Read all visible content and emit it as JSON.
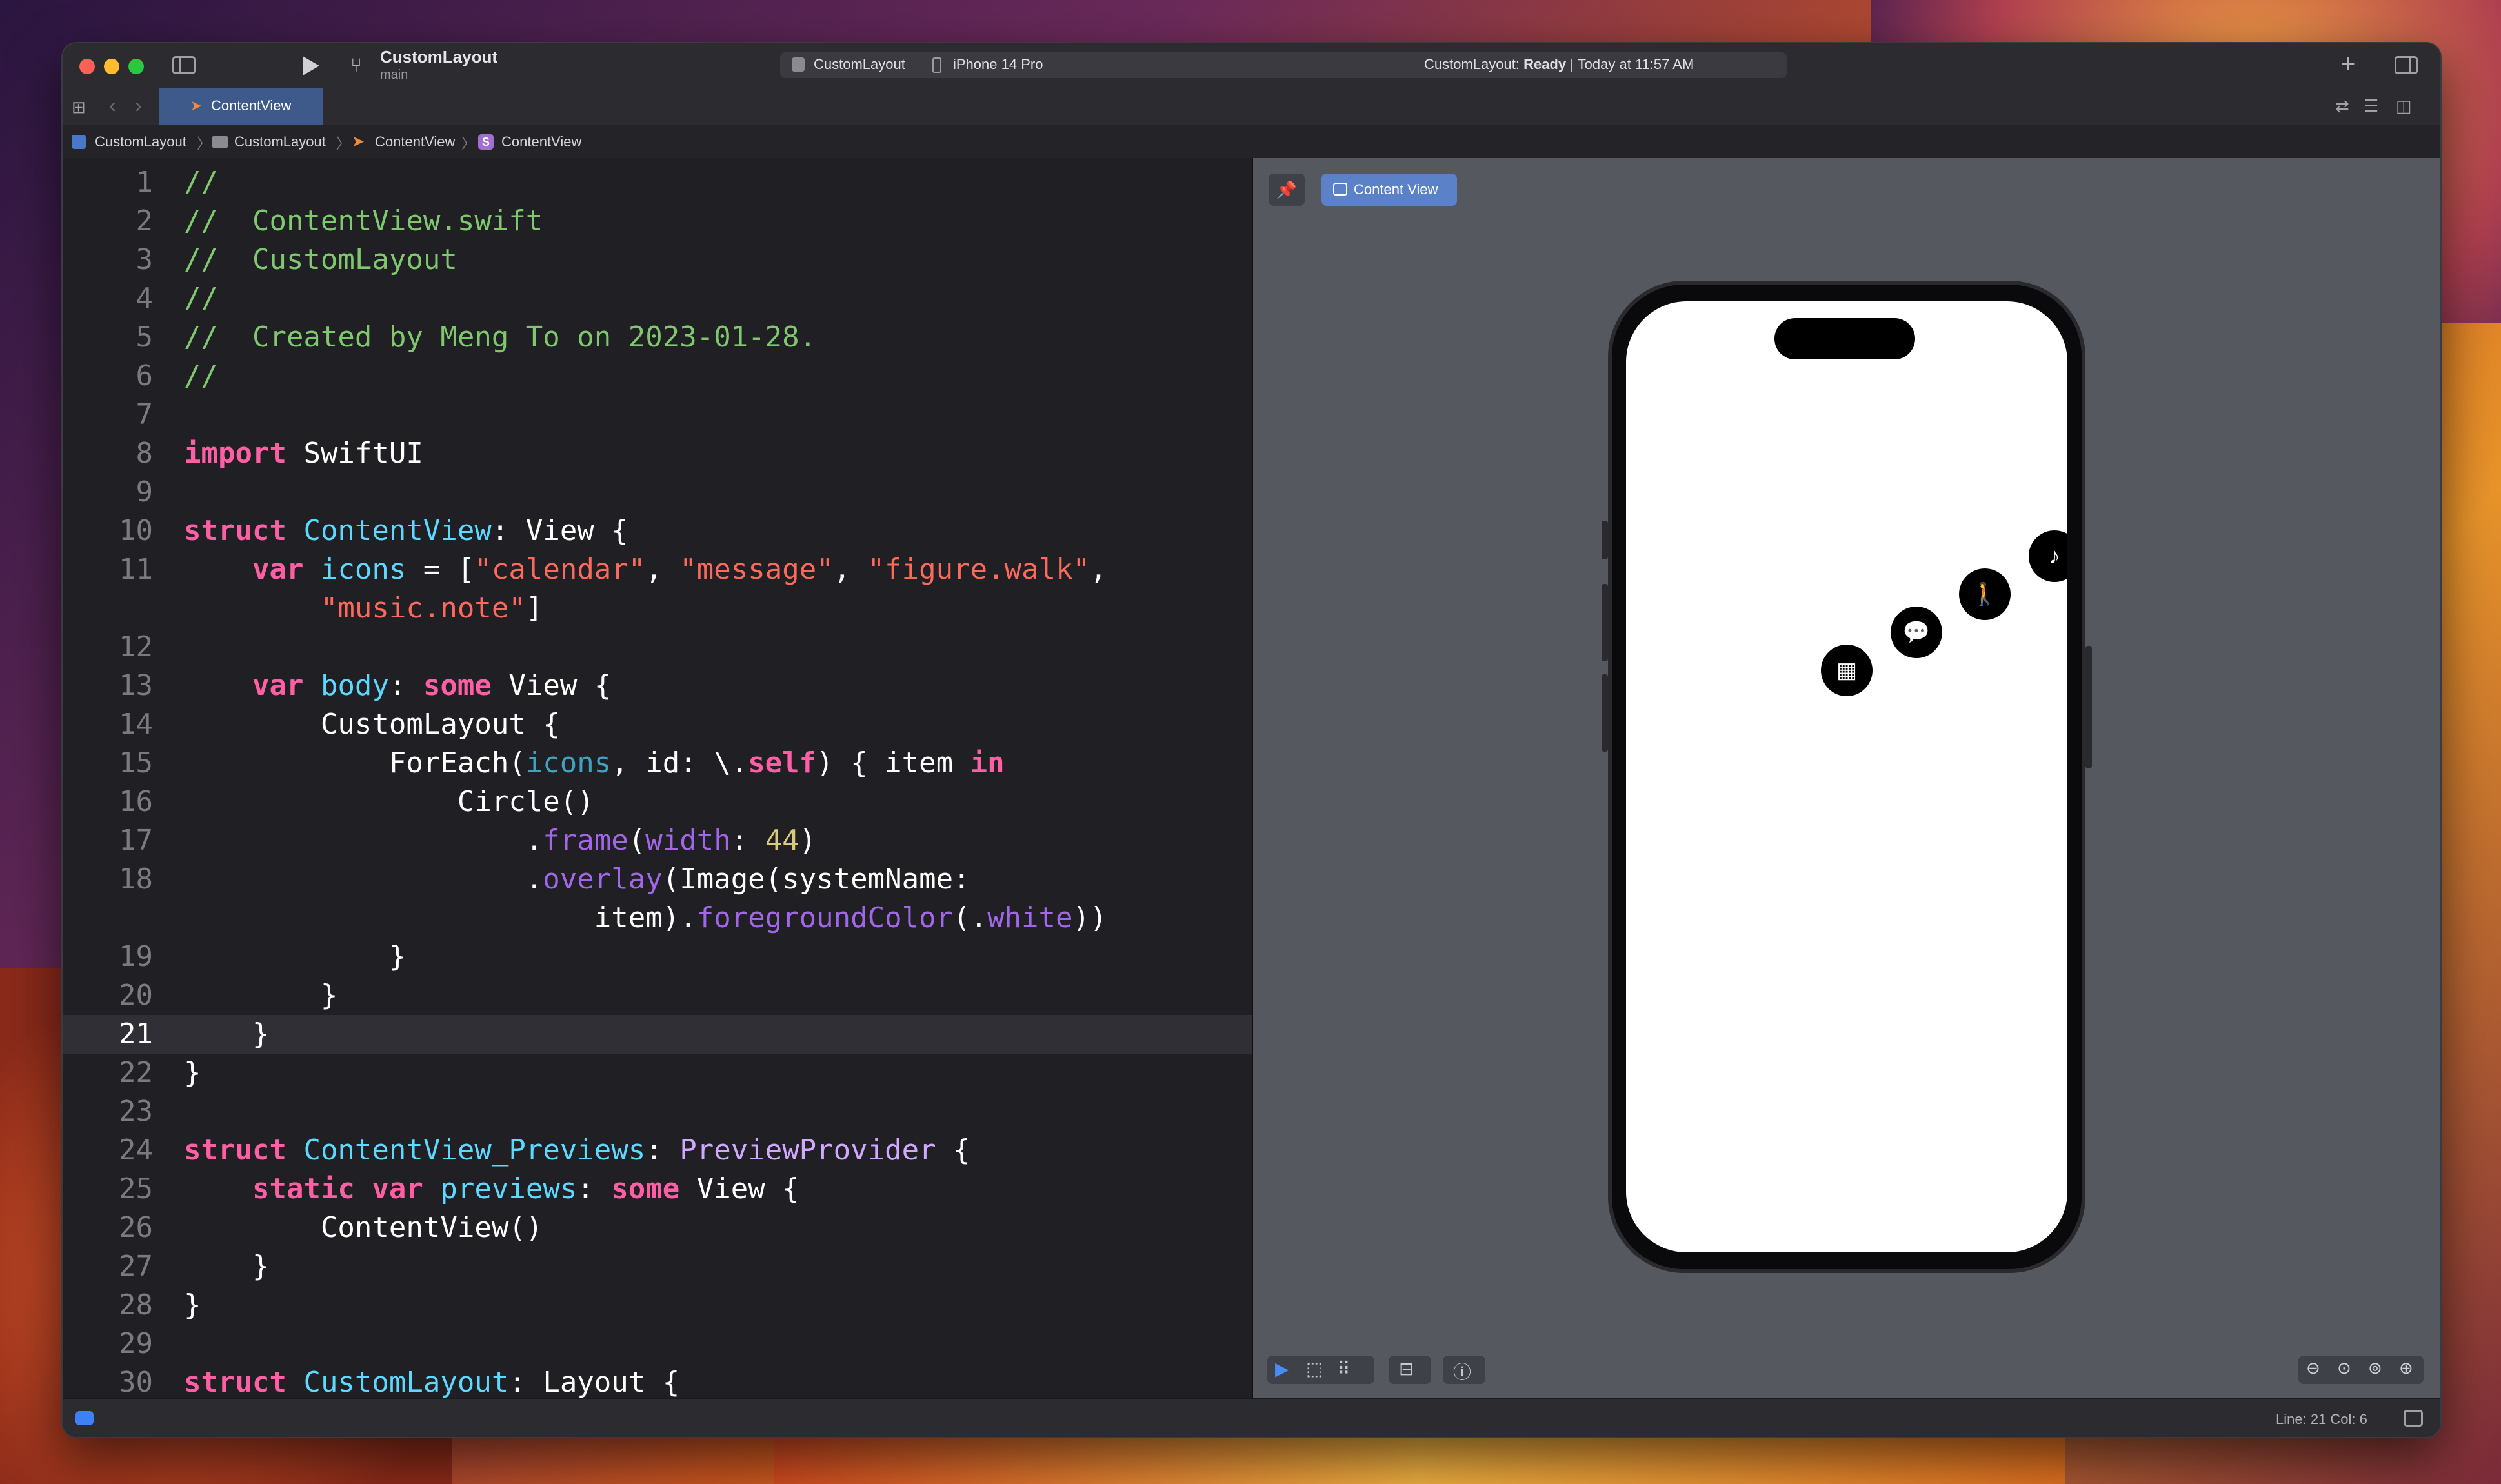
{
  "window": {
    "project": "CustomLayout",
    "branch": "main",
    "scheme": "CustomLayout",
    "device": "iPhone 14 Pro",
    "status_prefix": "CustomLayout: ",
    "status_bold": "Ready",
    "status_suffix": " | Today at 11:57 AM"
  },
  "tabs": [
    {
      "label": "ContentView"
    }
  ],
  "breadcrumb": [
    "CustomLayout",
    "CustomLayout",
    "ContentView",
    "ContentView"
  ],
  "editor": {
    "current_line": 21,
    "lines": [
      {
        "n": "1",
        "t": [
          [
            "c",
            "//"
          ]
        ]
      },
      {
        "n": "2",
        "t": [
          [
            "c",
            "//  ContentView.swift"
          ]
        ]
      },
      {
        "n": "3",
        "t": [
          [
            "c",
            "//  CustomLayout"
          ]
        ]
      },
      {
        "n": "4",
        "t": [
          [
            "c",
            "//"
          ]
        ]
      },
      {
        "n": "5",
        "t": [
          [
            "c",
            "//  Created by Meng To on 2023-01-28."
          ]
        ]
      },
      {
        "n": "6",
        "t": [
          [
            "c",
            "//"
          ]
        ]
      },
      {
        "n": "7",
        "t": []
      },
      {
        "n": "8",
        "t": [
          [
            "k",
            "import"
          ],
          [
            "p",
            " SwiftUI"
          ]
        ]
      },
      {
        "n": "9",
        "t": []
      },
      {
        "n": "10",
        "t": [
          [
            "k",
            "struct"
          ],
          [
            "p",
            " "
          ],
          [
            "ty",
            "ContentView"
          ],
          [
            "p",
            ": View {"
          ]
        ]
      },
      {
        "n": "11",
        "t": [
          [
            "p",
            "    "
          ],
          [
            "k",
            "var"
          ],
          [
            "p",
            " "
          ],
          [
            "ty",
            "icons"
          ],
          [
            "p",
            " = ["
          ],
          [
            "s",
            "\"calendar\""
          ],
          [
            "p",
            ", "
          ],
          [
            "s",
            "\"message\""
          ],
          [
            "p",
            ", "
          ],
          [
            "s",
            "\"figure.walk\""
          ],
          [
            "p",
            ","
          ]
        ]
      },
      {
        "n": "",
        "t": [
          [
            "p",
            "        "
          ],
          [
            "s",
            "\"music.note\""
          ],
          [
            "p",
            "]"
          ]
        ]
      },
      {
        "n": "12",
        "t": []
      },
      {
        "n": "13",
        "t": [
          [
            "p",
            "    "
          ],
          [
            "k",
            "var"
          ],
          [
            "p",
            " "
          ],
          [
            "ty",
            "body"
          ],
          [
            "p",
            ": "
          ],
          [
            "k",
            "some"
          ],
          [
            "p",
            " View {"
          ]
        ]
      },
      {
        "n": "14",
        "t": [
          [
            "p",
            "        CustomLayout {"
          ]
        ]
      },
      {
        "n": "15",
        "t": [
          [
            "p",
            "            ForEach("
          ],
          [
            "pr",
            "icons"
          ],
          [
            "p",
            ", id: \\."
          ],
          [
            "k",
            "self"
          ],
          [
            "p",
            ") { item "
          ],
          [
            "k",
            "in"
          ]
        ]
      },
      {
        "n": "16",
        "t": [
          [
            "p",
            "                Circle()"
          ]
        ]
      },
      {
        "n": "17",
        "t": [
          [
            "p",
            "                    ."
          ],
          [
            "m",
            "frame"
          ],
          [
            "p",
            "("
          ],
          [
            "m",
            "width"
          ],
          [
            "p",
            ": "
          ],
          [
            "n",
            "44"
          ],
          [
            "p",
            ")"
          ]
        ]
      },
      {
        "n": "18",
        "t": [
          [
            "p",
            "                    ."
          ],
          [
            "m",
            "overlay"
          ],
          [
            "p",
            "(Image(systemName:"
          ]
        ]
      },
      {
        "n": "",
        "t": [
          [
            "p",
            "                        item)."
          ],
          [
            "m",
            "foregroundColor"
          ],
          [
            "p",
            "(."
          ],
          [
            "m",
            "white"
          ],
          [
            "p",
            "))"
          ]
        ]
      },
      {
        "n": "19",
        "t": [
          [
            "p",
            "            }"
          ]
        ]
      },
      {
        "n": "20",
        "t": [
          [
            "p",
            "        }"
          ]
        ]
      },
      {
        "n": "21",
        "t": [
          [
            "p",
            "    }"
          ]
        ]
      },
      {
        "n": "22",
        "t": [
          [
            "p",
            "}"
          ]
        ]
      },
      {
        "n": "23",
        "t": []
      },
      {
        "n": "24",
        "t": [
          [
            "k",
            "struct"
          ],
          [
            "p",
            " "
          ],
          [
            "ty",
            "ContentView_Previews"
          ],
          [
            "p",
            ": "
          ],
          [
            "tb",
            "PreviewProvider"
          ],
          [
            "p",
            " {"
          ]
        ]
      },
      {
        "n": "25",
        "t": [
          [
            "p",
            "    "
          ],
          [
            "k",
            "static var"
          ],
          [
            "p",
            " "
          ],
          [
            "ty",
            "previews"
          ],
          [
            "p",
            ": "
          ],
          [
            "k",
            "some"
          ],
          [
            "p",
            " View {"
          ]
        ]
      },
      {
        "n": "26",
        "t": [
          [
            "p",
            "        ContentView()"
          ]
        ]
      },
      {
        "n": "27",
        "t": [
          [
            "p",
            "    }"
          ]
        ]
      },
      {
        "n": "28",
        "t": [
          [
            "p",
            "}"
          ]
        ]
      },
      {
        "n": "29",
        "t": []
      },
      {
        "n": "30",
        "t": [
          [
            "k",
            "struct"
          ],
          [
            "p",
            " "
          ],
          [
            "ty",
            "CustomLayout"
          ],
          [
            "p",
            ": Layout {"
          ]
        ]
      }
    ]
  },
  "preview": {
    "label": "Content View",
    "icons": [
      "calendar-icon",
      "message-icon",
      "figure-walk-icon",
      "music-note-icon"
    ]
  },
  "statusbar": {
    "position": "Line: 21  Col: 6"
  },
  "colors": {
    "keyword": "#fc5fa3",
    "comment": "#7fc86e",
    "string": "#fc6a5d",
    "type": "#5dd8ff",
    "accent": "#3d5a8a"
  }
}
